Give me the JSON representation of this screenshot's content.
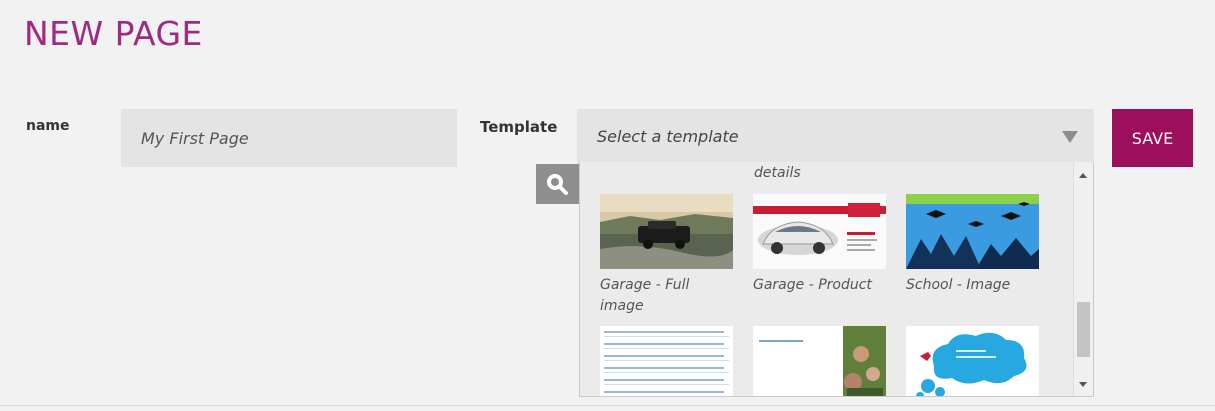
{
  "page": {
    "title": "NEW PAGE"
  },
  "form": {
    "name_label": "name",
    "name_value": "My First Page",
    "template_label": "Template",
    "template_placeholder": "Select a template",
    "save_label": "SAVE"
  },
  "dropdown": {
    "group_label": "details",
    "templates": [
      {
        "caption": "Garage - Full image"
      },
      {
        "caption": "Garage - Product"
      },
      {
        "caption": "School - Image"
      },
      {
        "caption": ""
      },
      {
        "caption": ""
      },
      {
        "caption": ""
      }
    ]
  },
  "colors": {
    "accent": "#a02a80",
    "save_button": "#9c0f5d",
    "background": "#f3f2f2",
    "field_background": "#e4e4e4"
  },
  "icons": {
    "zoom": "magnifier-icon",
    "select_arrow": "triangle-down-icon"
  }
}
